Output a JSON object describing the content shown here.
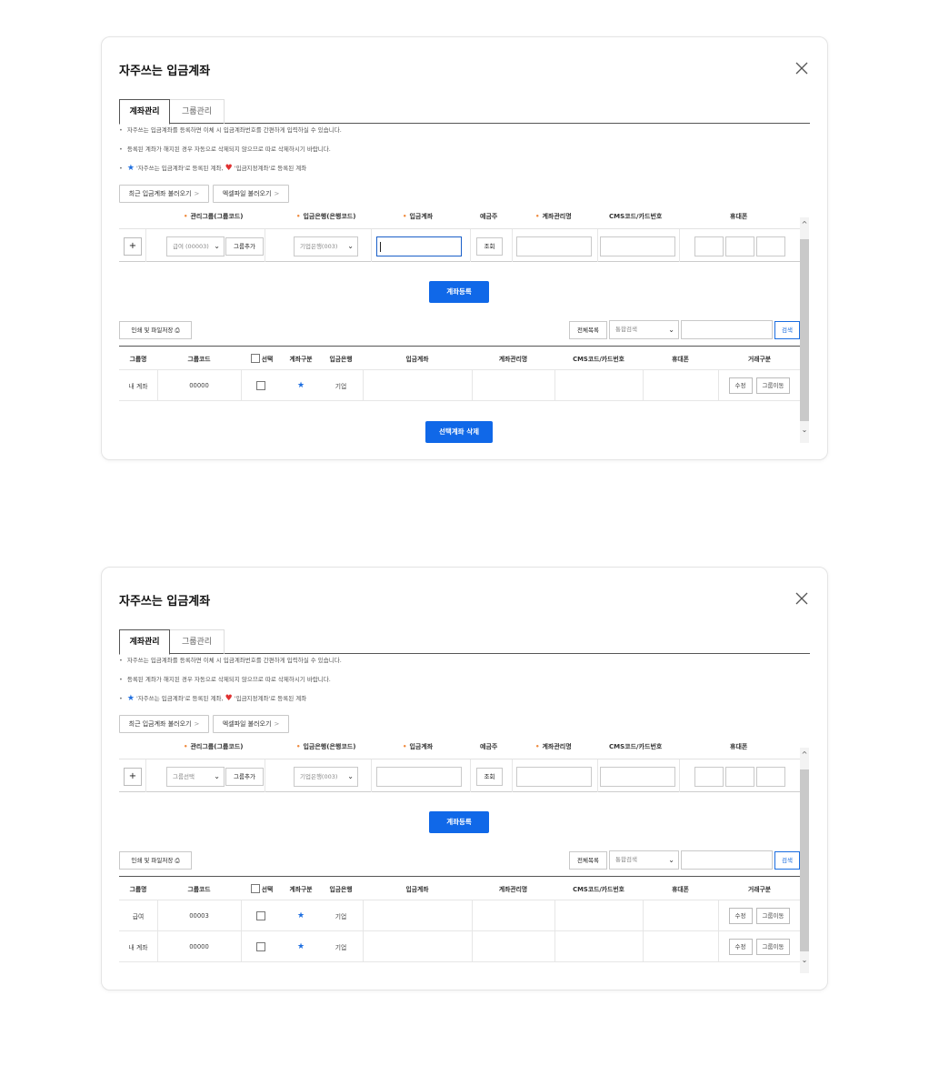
{
  "dialog_title": "자주쓰는 입금계좌",
  "close_label": "×",
  "tabs": [
    {
      "label": "계좌관리",
      "active": true
    },
    {
      "label": "그룹관리",
      "active": false
    }
  ],
  "notes": {
    "line1": "자주쓰는 입금계좌를 등록하면 이체 시 입금계좌번호를 간편하게 입력하실 수 있습니다.",
    "line2": "등록된 계좌가 해지된 경우 자동으로 삭제되지 않으므로 따로 삭제하시기 바랍니다.",
    "line3_a": "'자주쓰는 입금계좌'로 등록된 계좌,",
    "line3_b": "'입금지정계좌'로 등록된 계좌",
    "bullet": "•"
  },
  "load_buttons": {
    "recent": "최근 입금계좌 불러오기",
    "excel": "엑셀파일 불러오기",
    "chevron": ">"
  },
  "form_headers": {
    "group": "관리그룹(그룹코드)",
    "bank": "입금은행(은행코드)",
    "account": "입금계좌",
    "holder": "예금주",
    "name": "계좌관리명",
    "cms": "CMS코드/카드번호",
    "phone": "휴대폰",
    "required_mark": "•"
  },
  "form": {
    "plus": "+",
    "add_group": "그룹추가",
    "lookup": "조회",
    "bank_value": "기업은행(003)",
    "dropdown_arrow": "⌄"
  },
  "register_button": "계좌등록",
  "print_button": "인쇄 및 파일저장",
  "search": {
    "all_list": "전체목록",
    "select_value": "통합검색",
    "button": "검색"
  },
  "list_headers": {
    "group_name": "그룹명",
    "group_code": "그룹코드",
    "select": "선택",
    "type": "계좌구분",
    "bank": "입금은행",
    "account": "입금계좌",
    "name": "계좌관리명",
    "cms": "CMS코드/카드번호",
    "phone": "휴대폰",
    "action": "거래구분"
  },
  "row_buttons": {
    "edit": "수정",
    "move": "그룹이동"
  },
  "scroll": {
    "up": "^",
    "down": "⌄"
  },
  "panel1": {
    "group_select_value": "급여 (00003)",
    "rows": [
      {
        "group_name": "내 계좌",
        "group_code": "00000",
        "bank": "기업"
      }
    ],
    "delete_button": "선택계좌 삭제"
  },
  "panel2": {
    "group_select_value": "그룹선택",
    "rows": [
      {
        "group_name": "급여",
        "group_code": "00003",
        "bank": "기업"
      },
      {
        "group_name": "내 계좌",
        "group_code": "00000",
        "bank": "기업"
      }
    ]
  },
  "colors": {
    "primary": "#1068e8",
    "star": "#1f6fe0",
    "heart": "#e03131",
    "required": "#f08a3c"
  }
}
